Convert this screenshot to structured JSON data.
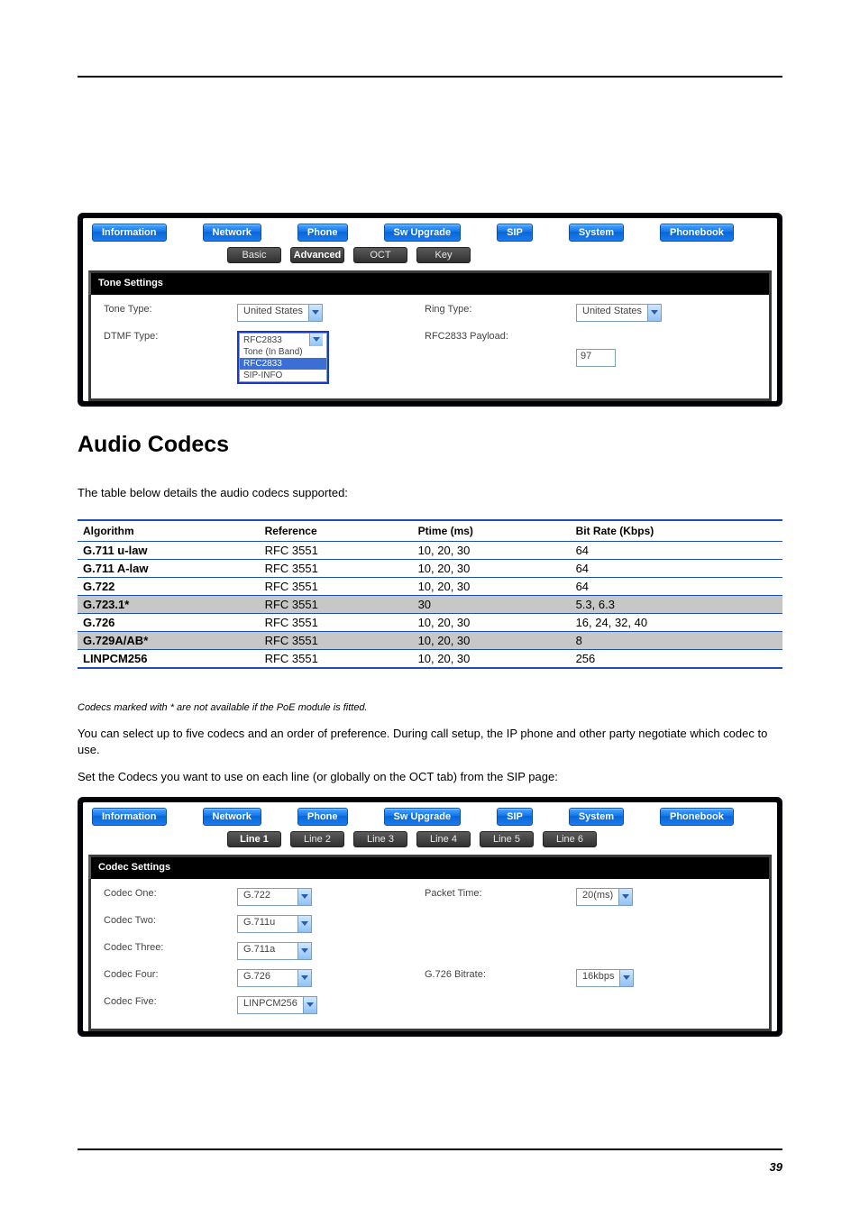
{
  "nav": {
    "information": "Information",
    "network": "Network",
    "phone": "Phone",
    "sw_upgrade": "Sw Upgrade",
    "sip": "SIP",
    "system": "System",
    "phonebook": "Phonebook"
  },
  "tone_panel": {
    "sub": {
      "basic": "Basic",
      "advanced": "Advanced",
      "oct": "OCT",
      "key": "Key"
    },
    "title": "Tone Settings",
    "labels": {
      "tone_type": "Tone Type:",
      "ring_type": "Ring Type:",
      "dtmf_type": "DTMF Type:",
      "rfc_payload": "RFC2833 Payload:"
    },
    "values": {
      "tone_type": "United States",
      "ring_type": "United States",
      "rfc_payload": "97"
    },
    "dtmf_options": {
      "o1": "RFC2833",
      "o2": "Tone (In Band)",
      "o3": "RFC2833",
      "o4": "SIP-INFO"
    }
  },
  "audio_heading": "Audio Codecs",
  "audio_intro": "The table below details the audio codecs supported:",
  "codec_table": {
    "h1": "Algorithm",
    "h2": "Reference",
    "h3": "Ptime (ms)",
    "h4": "Bit Rate (Kbps)",
    "rows": {
      "r0": {
        "name": "G.711 u-law",
        "ref": "RFC 3551",
        "pt": "10, 20, 30",
        "br": "64"
      },
      "r1": {
        "name": "G.711 A-law",
        "ref": "RFC 3551",
        "pt": "10, 20, 30",
        "br": "64"
      },
      "r2": {
        "name": "G.722",
        "ref": "RFC 3551",
        "pt": "10, 20, 30",
        "br": "64"
      },
      "r3": {
        "name": "G.723.1*",
        "ref": "RFC 3551",
        "pt": "30",
        "br": "5.3, 6.3"
      },
      "r4": {
        "name": "G.726",
        "ref": "RFC 3551",
        "pt": "10, 20, 30",
        "br": "16, 24, 32, 40"
      },
      "r5": {
        "name": "G.729A/AB*",
        "ref": "RFC 3551",
        "pt": "10, 20, 30",
        "br": "8"
      },
      "r6": {
        "name": "LINPCM256",
        "ref": "RFC 3551",
        "pt": "10, 20, 30",
        "br": "256"
      }
    }
  },
  "codec_footnote": "Codecs marked with * are not available if the PoE module is fitted.",
  "codec_body1": "You can select up to five codecs and an order of preference. During call setup, the IP phone and other party negotiate which codec to use.",
  "codec_body2": "Set the Codecs you want to use on each line (or globally on the OCT tab) from the SIP page:",
  "codec_panel": {
    "sub": {
      "l1": "Line 1",
      "l2": "Line 2",
      "l3": "Line 3",
      "l4": "Line 4",
      "l5": "Line 5",
      "l6": "Line 6"
    },
    "title": "Codec Settings",
    "labels": {
      "c1": "Codec One:",
      "c2": "Codec Two:",
      "c3": "Codec Three:",
      "c4": "Codec Four:",
      "c5": "Codec Five:",
      "packet_time": "Packet Time:",
      "g726_bitrate": "G.726 Bitrate:"
    },
    "values": {
      "c1": "G.722",
      "c2": "G.711u",
      "c3": "G.711a",
      "c4": "G.726",
      "c5": "LINPCM256",
      "packet_time": "20(ms)",
      "g726_bitrate": "16kbps"
    }
  },
  "page_number": "39"
}
